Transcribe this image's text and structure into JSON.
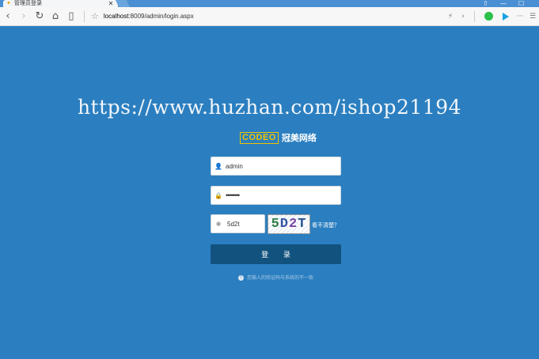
{
  "browser": {
    "tab_title": "管理员登录",
    "tab_close": "✕",
    "url_host": "localhost",
    "url_rest": ":8009/admin/login.aspx",
    "back": "‹",
    "forward": "›",
    "reload": "↻",
    "home": "⌂",
    "reader": "▯",
    "star": "☆",
    "menu_more": "···",
    "menu_lines": "☰",
    "win_min": "—",
    "win_max": "☐",
    "win_pin": "⇧"
  },
  "page": {
    "watermark": "https://www.huzhan.com/ishop21194",
    "logo_mark": "CODEO",
    "logo_text": "冠美网络",
    "username_value": "admin",
    "password_value": "••••••••",
    "code_value": "5d2t",
    "captcha_text": "5D2T",
    "captcha_refresh": "看不清楚？",
    "login_button": "登 录",
    "error_message": "您输入的验证码与系统的不一致"
  },
  "colors": {
    "background": "#2b7fc0",
    "button": "#12527e"
  }
}
